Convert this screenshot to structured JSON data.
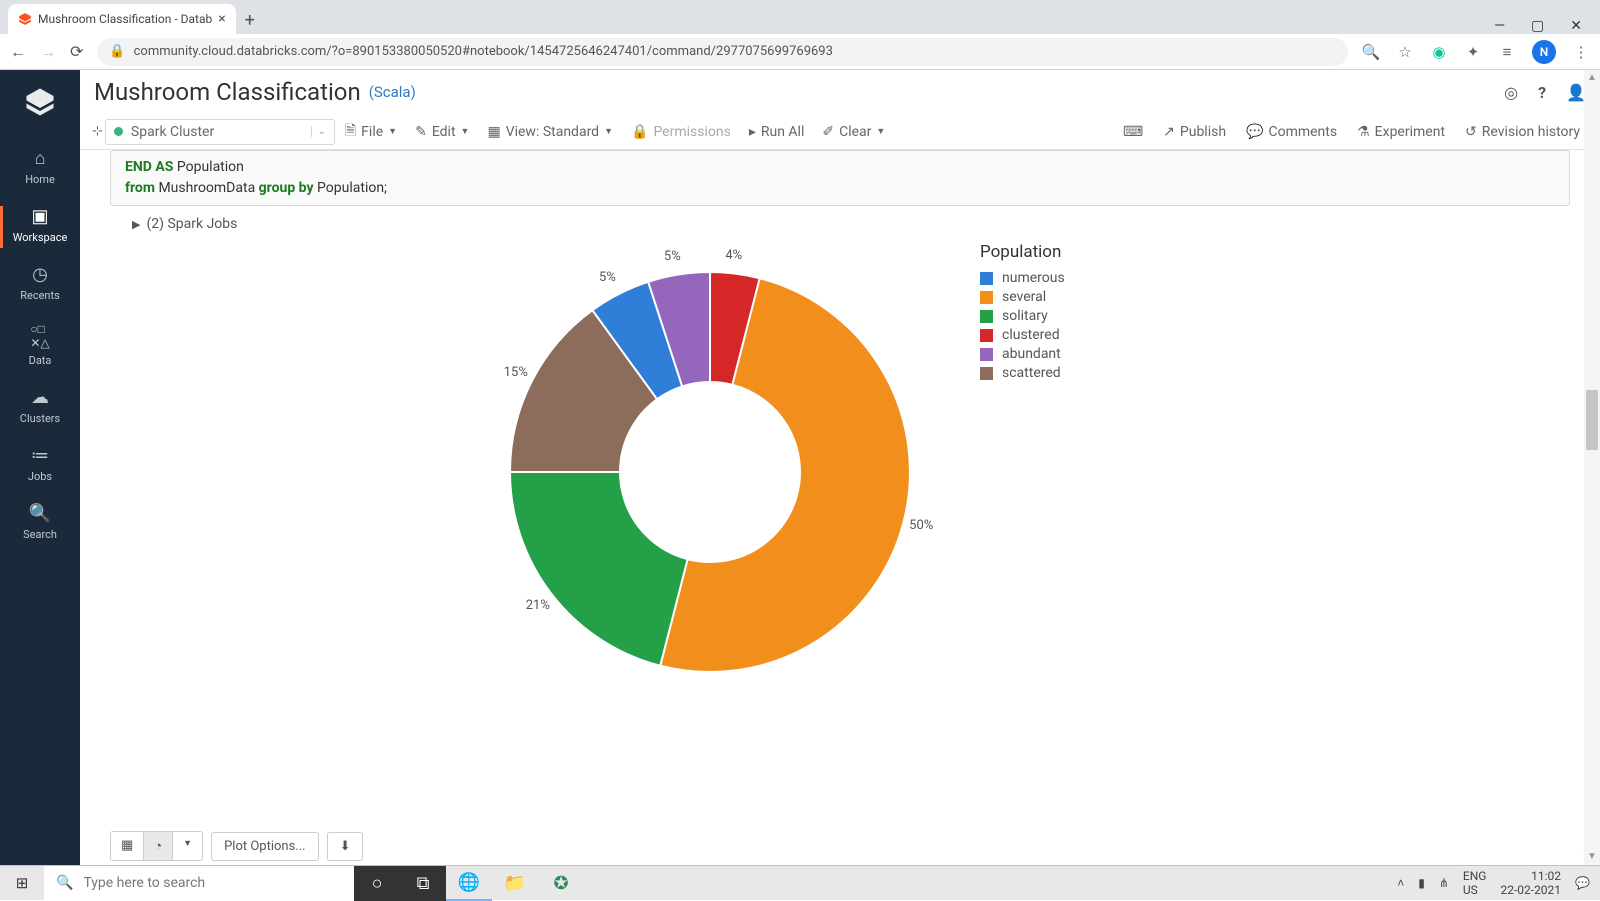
{
  "browser": {
    "tab_title": "Mushroom Classification - Datab",
    "url": "community.cloud.databricks.com/?o=890153380050520#notebook/1454725646247401/command/2977075699769693",
    "avatar_letter": "N"
  },
  "sidebar": {
    "items": [
      {
        "label": "Home"
      },
      {
        "label": "Workspace"
      },
      {
        "label": "Recents"
      },
      {
        "label": "Data"
      },
      {
        "label": "Clusters"
      },
      {
        "label": "Jobs"
      },
      {
        "label": "Search"
      }
    ]
  },
  "notebook": {
    "title": "Mushroom Classification",
    "lang": "(Scala)",
    "cluster": "Spark Cluster",
    "toolbar": {
      "file": "File",
      "edit": "Edit",
      "view": "View: Standard",
      "permissions": "Permissions",
      "runall": "Run All",
      "clear": "Clear",
      "publish": "Publish",
      "comments": "Comments",
      "experiment": "Experiment",
      "revision": "Revision history"
    },
    "code_line1a": "END",
    "code_line1b": "AS",
    "code_line1c": "Population",
    "code_line2a": "from",
    "code_line2b": "MushroomData",
    "code_line2c": "group by",
    "code_line2d": "Population;",
    "spark_jobs": "(2) Spark Jobs",
    "plot_options": "Plot Options..."
  },
  "chart_data": {
    "type": "pie",
    "title": "Population",
    "series": [
      {
        "name": "numerous",
        "value": 5,
        "color": "#2f7ed8",
        "label": "5%"
      },
      {
        "name": "several",
        "value": 50,
        "color": "#f28e1c",
        "label": "50%"
      },
      {
        "name": "solitary",
        "value": 21,
        "color": "#24a148",
        "label": "21%"
      },
      {
        "name": "clustered",
        "value": 4,
        "color": "#d62728",
        "label": "4%"
      },
      {
        "name": "abundant",
        "value": 5,
        "color": "#9467bd",
        "label": "5%"
      },
      {
        "name": "scattered",
        "value": 15,
        "color": "#8c6d5b",
        "label": "15%"
      }
    ]
  },
  "taskbar": {
    "search_placeholder": "Type here to search",
    "lang1": "ENG",
    "lang2": "US",
    "time": "11:02",
    "date": "22-02-2021"
  }
}
